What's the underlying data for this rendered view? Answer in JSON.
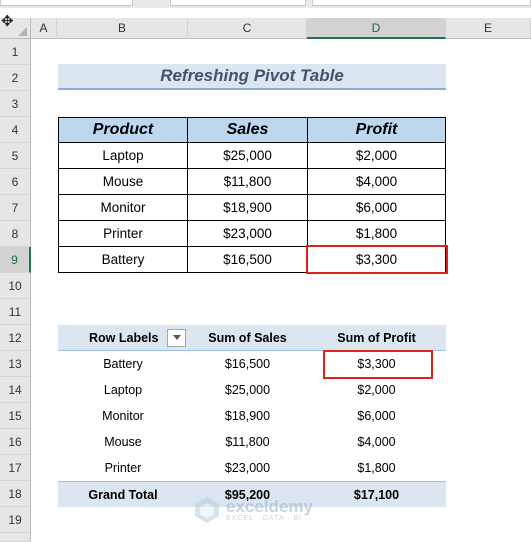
{
  "columns": [
    "A",
    "B",
    "C",
    "D",
    "E"
  ],
  "selected_column": "D",
  "rows": [
    "1",
    "2",
    "3",
    "4",
    "5",
    "6",
    "7",
    "8",
    "9",
    "10",
    "11",
    "12",
    "13",
    "14",
    "15",
    "16",
    "17",
    "18",
    "19"
  ],
  "selected_row": "9",
  "title": "Refreshing Pivot Table",
  "source_table": {
    "headers": [
      "Product",
      "Sales",
      "Profit"
    ],
    "rows": [
      [
        "Laptop",
        "$25,000",
        "$2,000"
      ],
      [
        "Mouse",
        "$11,800",
        "$4,000"
      ],
      [
        "Monitor",
        "$18,900",
        "$6,000"
      ],
      [
        "Printer",
        "$23,000",
        "$1,800"
      ],
      [
        "Battery",
        "$16,500",
        "$3,300"
      ]
    ],
    "highlighted_cell": "D9"
  },
  "pivot_table": {
    "headers": [
      "Row Labels",
      "Sum of Sales",
      "Sum of Profit"
    ],
    "rows": [
      [
        "Battery",
        "$16,500",
        "$3,300"
      ],
      [
        "Laptop",
        "$25,000",
        "$2,000"
      ],
      [
        "Monitor",
        "$18,900",
        "$6,000"
      ],
      [
        "Mouse",
        "$11,800",
        "$4,000"
      ],
      [
        "Printer",
        "$23,000",
        "$1,800"
      ]
    ],
    "total": [
      "Grand Total",
      "$95,200",
      "$17,100"
    ],
    "highlighted_cell": "D13"
  },
  "watermark": {
    "name": "exceldemy",
    "tagline": "EXCEL · DATA · BI"
  },
  "colors": {
    "accent_green": "#217346",
    "highlight_red": "#e0201b",
    "header_blue": "#bdd7ee",
    "pivot_blue": "#dce6f1"
  }
}
